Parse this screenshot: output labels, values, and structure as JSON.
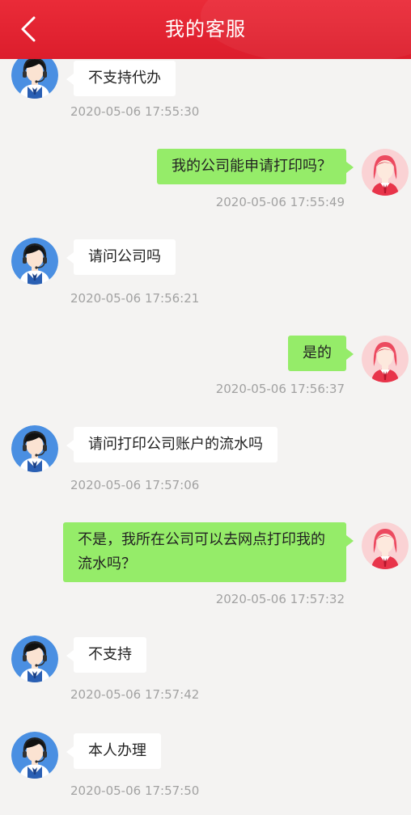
{
  "header": {
    "title": "我的客服",
    "back_icon": "chevron-left-icon",
    "color": "#e42431"
  },
  "messages": [
    {
      "side": "agent",
      "text": "不支持代办",
      "time": "2020-05-06 17:55:30"
    },
    {
      "side": "user",
      "text": "我的公司能申请打印吗？",
      "time": "2020-05-06 17:55:49"
    },
    {
      "side": "agent",
      "text": "请问公司吗",
      "time": "2020-05-06 17:56:21"
    },
    {
      "side": "user",
      "text": "是的",
      "time": "2020-05-06 17:56:37"
    },
    {
      "side": "agent",
      "text": "请问打印公司账户的流水吗",
      "time": "2020-05-06 17:57:06"
    },
    {
      "side": "user",
      "text": "不是，我所在公司可以去网点打印我的流水吗？",
      "time": "2020-05-06 17:57:32"
    },
    {
      "side": "agent",
      "text": "不支持",
      "time": "2020-05-06 17:57:42"
    },
    {
      "side": "agent",
      "text": "本人办理",
      "time": "2020-05-06 17:57:50"
    }
  ],
  "colors": {
    "agent_bubble": "#ffffff",
    "user_bubble": "#95ec69",
    "timestamp": "#a2a2a2",
    "background": "#f4f3f2"
  }
}
